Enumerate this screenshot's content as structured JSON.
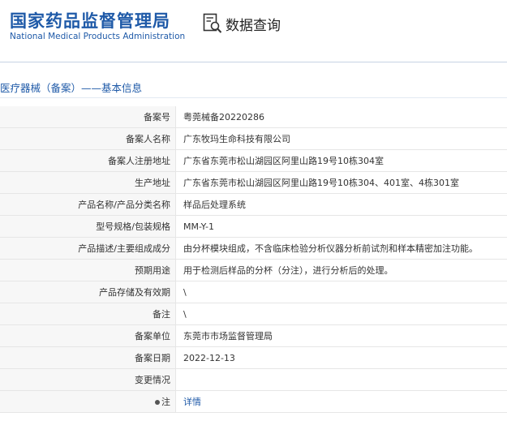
{
  "header": {
    "logo_cn": "国家药品监督管理局",
    "logo_en": "National Medical Products Administration",
    "query_title": "数据查询"
  },
  "section": {
    "title": "医疗器械（备案）——基本信息"
  },
  "rows": [
    {
      "label": "备案号",
      "value": "粤莞械备20220286"
    },
    {
      "label": "备案人名称",
      "value": "广东牧玛生命科技有限公司"
    },
    {
      "label": "备案人注册地址",
      "value": "广东省东莞市松山湖园区阿里山路19号10栋304室"
    },
    {
      "label": "生产地址",
      "value": "广东省东莞市松山湖园区阿里山路19号10栋304、401室、4栋301室"
    },
    {
      "label": "产品名称/产品分类名称",
      "value": "样品后处理系统"
    },
    {
      "label": "型号规格/包装规格",
      "value": "MM-Y-1"
    },
    {
      "label": "产品描述/主要组成成分",
      "value": "由分杯模块组成，不含临床检验分析仪器分析前试剂和样本精密加注功能。"
    },
    {
      "label": "预期用途",
      "value": "用于检测后样品的分杯（分注），进行分析后的处理。"
    },
    {
      "label": "产品存储及有效期",
      "value": "\\"
    },
    {
      "label": "备注",
      "value": "\\"
    },
    {
      "label": "备案单位",
      "value": "东莞市市场监督管理局"
    },
    {
      "label": "备案日期",
      "value": "2022-12-13"
    },
    {
      "label": "变更情况",
      "value": ""
    },
    {
      "label": "注",
      "value": "详情"
    }
  ]
}
